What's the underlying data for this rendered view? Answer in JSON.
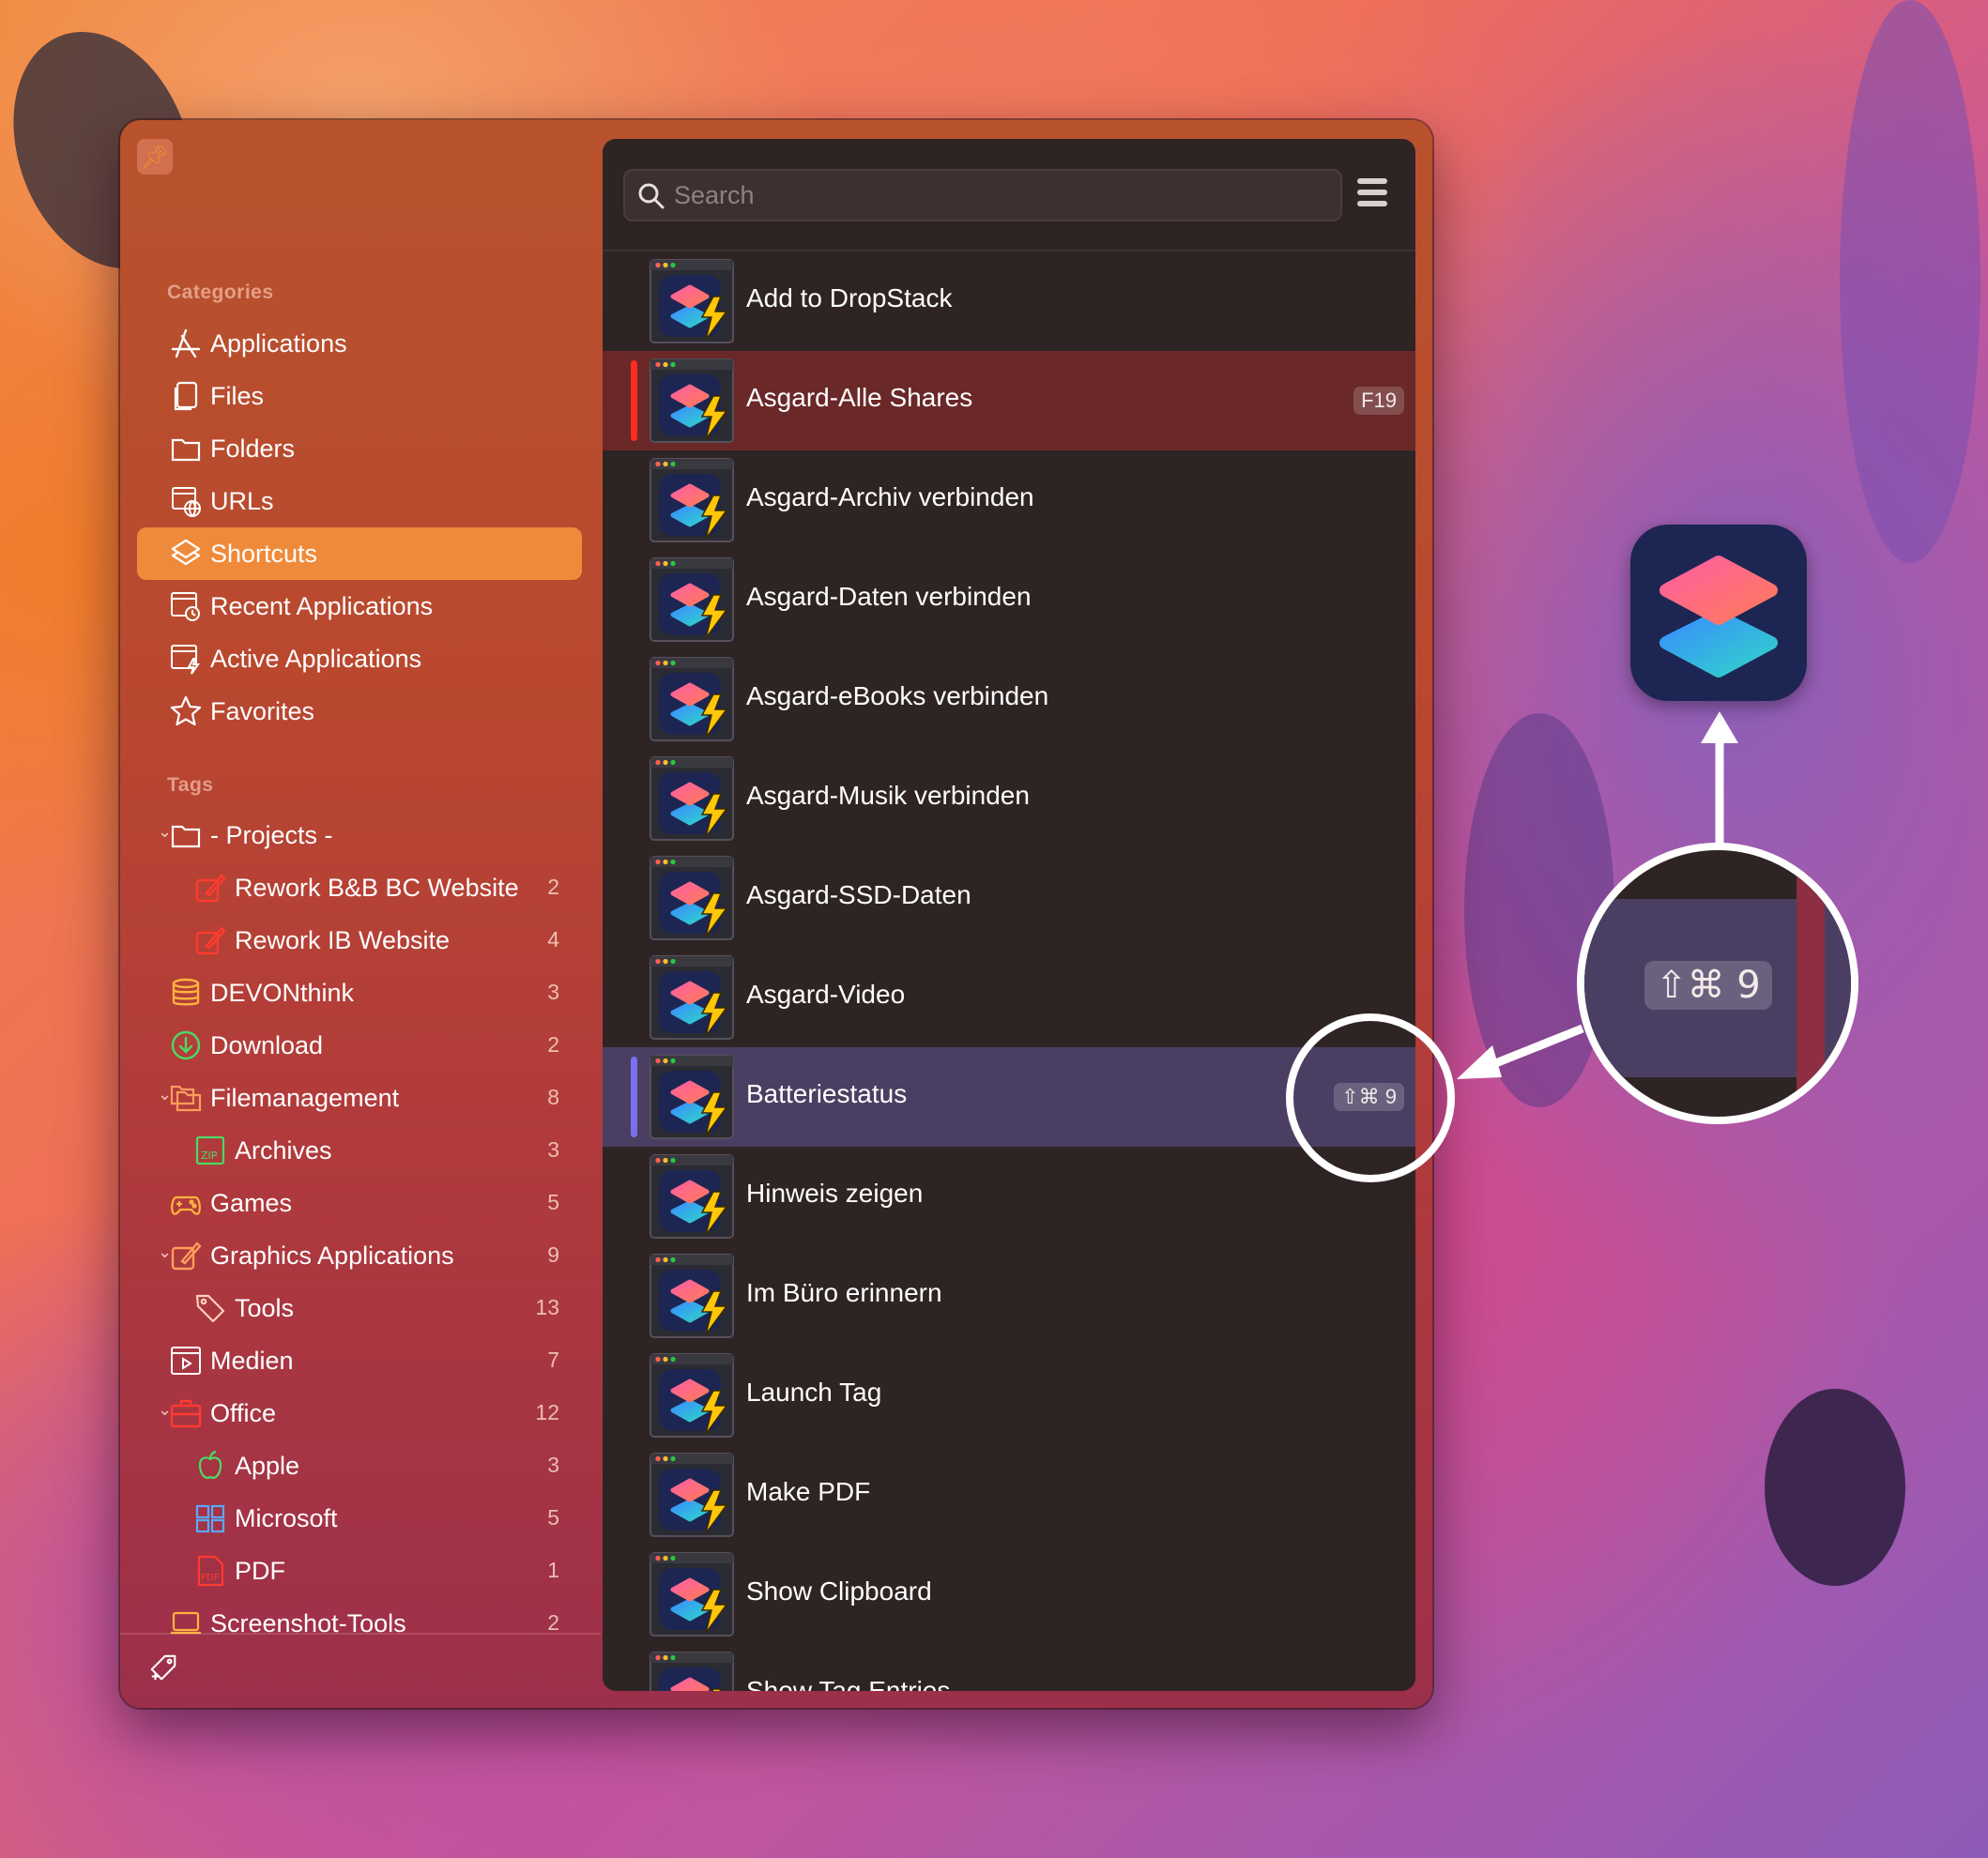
{
  "sidebar": {
    "categories_label": "Categories",
    "tags_label": "Tags",
    "categories": [
      {
        "label": "Applications",
        "icon": "app-store-icon"
      },
      {
        "label": "Files",
        "icon": "files-icon"
      },
      {
        "label": "Folders",
        "icon": "folder-icon"
      },
      {
        "label": "URLs",
        "icon": "url-icon"
      },
      {
        "label": "Shortcuts",
        "icon": "shortcuts-icon",
        "selected": true
      },
      {
        "label": "Recent Applications",
        "icon": "recent-apps-icon"
      },
      {
        "label": "Active Applications",
        "icon": "active-apps-icon"
      },
      {
        "label": "Favorites",
        "icon": "star-icon"
      }
    ],
    "tags": [
      {
        "label": "- Projects -",
        "count": "",
        "icon": "folder-icon",
        "expanded": true
      },
      {
        "label": "Rework B&B BC Website",
        "count": "2",
        "icon": "graphics-app-icon"
      },
      {
        "label": "Rework IB Website",
        "count": "4",
        "icon": "graphics-app-icon"
      },
      {
        "label": "DEVONthink",
        "count": "3",
        "icon": "database-icon"
      },
      {
        "label": "Download",
        "count": "2",
        "icon": "download-icon"
      },
      {
        "label": "Filemanagement",
        "count": "8",
        "icon": "folders-icon",
        "expanded": true
      },
      {
        "label": "Archives",
        "count": "3",
        "icon": "zip-icon"
      },
      {
        "label": "Games",
        "count": "5",
        "icon": "gamepad-icon"
      },
      {
        "label": "Graphics Applications",
        "count": "9",
        "icon": "graphics-app-icon",
        "expanded": true
      },
      {
        "label": "Tools",
        "count": "13",
        "icon": "tag-icon"
      },
      {
        "label": "Medien",
        "count": "7",
        "icon": "media-icon"
      },
      {
        "label": "Office",
        "count": "12",
        "icon": "briefcase-icon",
        "expanded": true
      },
      {
        "label": "Apple",
        "count": "3",
        "icon": "apple-icon"
      },
      {
        "label": "Microsoft",
        "count": "5",
        "icon": "windows-icon"
      },
      {
        "label": "PDF",
        "count": "1",
        "icon": "pdf-icon"
      },
      {
        "label": "Screenshot-Tools",
        "count": "2",
        "icon": "laptop-icon"
      }
    ]
  },
  "search": {
    "placeholder": "Search",
    "value": ""
  },
  "list": [
    {
      "title": "Add to DropStack",
      "shortcut": ""
    },
    {
      "title": "Asgard-Alle Shares",
      "shortcut": "F19",
      "state": "active"
    },
    {
      "title": "Asgard-Archiv verbinden",
      "shortcut": ""
    },
    {
      "title": "Asgard-Daten verbinden",
      "shortcut": ""
    },
    {
      "title": "Asgard-eBooks verbinden",
      "shortcut": ""
    },
    {
      "title": "Asgard-Musik verbinden",
      "shortcut": ""
    },
    {
      "title": "Asgard-SSD-Daten",
      "shortcut": ""
    },
    {
      "title": "Asgard-Video",
      "shortcut": ""
    },
    {
      "title": "Batteriestatus",
      "shortcut": "⇧⌘ 9",
      "state": "hover"
    },
    {
      "title": "Hinweis zeigen",
      "shortcut": ""
    },
    {
      "title": "Im Büro erinnern",
      "shortcut": ""
    },
    {
      "title": "Launch Tag",
      "shortcut": ""
    },
    {
      "title": "Make PDF",
      "shortcut": ""
    },
    {
      "title": "Show Clipboard",
      "shortcut": ""
    },
    {
      "title": "Show Tag Entries",
      "shortcut": ""
    }
  ],
  "callout": {
    "zoom_shortcut": "⇧⌘ 9"
  },
  "colors": {
    "selected_sidebar": "#ef8a3a",
    "active_row": "#6a2828",
    "hover_row": "#4a3f62",
    "active_marker": "#ff2d1f",
    "hover_marker": "#7b6ff0"
  }
}
